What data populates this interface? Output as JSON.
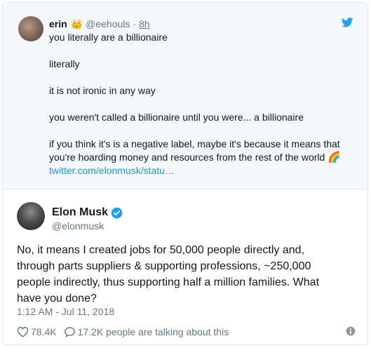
{
  "quoted_tweet": {
    "name": "erin",
    "handle": "@eehouls",
    "separator": "·",
    "time": "8h",
    "crown_emoji": "👑",
    "lines": [
      "you literally are a billionaire",
      "literally",
      "it is not ironic in any way",
      "you weren't called a billionaire until you were... a billionaire"
    ],
    "last_para_line1": "if you think it's is a negative label, maybe it's because it means that",
    "last_para_line2": "you're hoarding money and resources from the rest of the world",
    "rainbow_emoji": "🌈",
    "link": "twitter.com/elonmusk/statu…"
  },
  "tweet": {
    "name": "Elon Musk",
    "handle": "@elonmusk",
    "text_lines": [
      "No, it means I created jobs for 50,000 people directly and,",
      "through parts suppliers & supporting professions, ~250,000",
      "people indirectly, thus supporting half a million families. What",
      "have you done?"
    ],
    "timestamp": "1:12 AM - Jul 11, 2018",
    "likes": "78.4K",
    "talking": "17.2K people are talking about this"
  },
  "colors": {
    "twitter_blue": "#1da1f2",
    "link_blue": "#1b95e0",
    "secondary_text": "#657786",
    "quoted_bg": "#f5f8fa"
  },
  "icons": [
    "twitter-bird-icon",
    "verified-badge-icon",
    "heart-icon",
    "speech-bubble-icon",
    "info-icon"
  ]
}
